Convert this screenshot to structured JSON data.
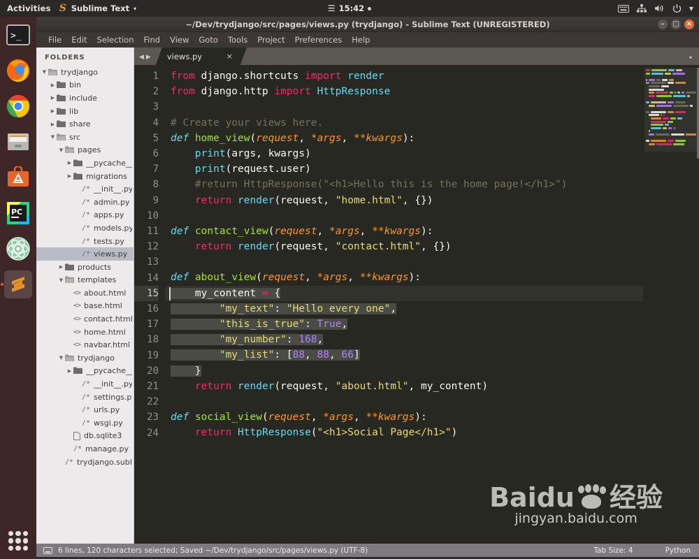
{
  "topbar": {
    "activities": "Activities",
    "app_name": "Sublime Text",
    "app_icon": "sublime-text-icon",
    "menu_chevron": "▾",
    "clock": "15:42",
    "clock_menu_icon": "hamburger-icon",
    "tray": [
      "keyboard-icon",
      "network-icon",
      "volume-icon",
      "power-icon",
      "chevron-down-icon"
    ]
  },
  "dock": {
    "items": [
      {
        "name": "terminal",
        "label": "Terminal"
      },
      {
        "name": "firefox",
        "label": "Firefox"
      },
      {
        "name": "chrome",
        "label": "Google Chrome"
      },
      {
        "name": "files",
        "label": "Files"
      },
      {
        "name": "ubuntu-software",
        "label": "Ubuntu Software"
      },
      {
        "name": "pycharm",
        "label": "PyCharm"
      },
      {
        "name": "atom",
        "label": "Atom"
      },
      {
        "name": "sublime-text",
        "label": "Sublime Text",
        "active": true
      }
    ],
    "show_apps_label": "Show Applications"
  },
  "window": {
    "title": "~/Dev/trydjango/src/pages/views.py (trydjango) - Sublime Text (UNREGISTERED)",
    "buttons": {
      "minimize": "–",
      "maximize": "□",
      "close": "×"
    }
  },
  "menubar": [
    "File",
    "Edit",
    "Selection",
    "Find",
    "View",
    "Goto",
    "Tools",
    "Project",
    "Preferences",
    "Help"
  ],
  "sidebar": {
    "header": "FOLDERS",
    "tree": [
      {
        "indent": 0,
        "arrow": "▾",
        "icon": "folder-open-icon",
        "label": "trydjango"
      },
      {
        "indent": 1,
        "arrow": "▸",
        "icon": "folder-icon",
        "label": "bin"
      },
      {
        "indent": 1,
        "arrow": "▸",
        "icon": "folder-icon",
        "label": "include"
      },
      {
        "indent": 1,
        "arrow": "▸",
        "icon": "folder-icon",
        "label": "lib"
      },
      {
        "indent": 1,
        "arrow": "▸",
        "icon": "folder-icon",
        "label": "share"
      },
      {
        "indent": 1,
        "arrow": "▾",
        "icon": "folder-open-icon",
        "label": "src"
      },
      {
        "indent": 2,
        "arrow": "▾",
        "icon": "folder-open-icon",
        "label": "pages"
      },
      {
        "indent": 3,
        "arrow": "▸",
        "icon": "folder-icon",
        "label": "__pycache__"
      },
      {
        "indent": 3,
        "arrow": "▸",
        "icon": "folder-icon",
        "label": "migrations"
      },
      {
        "indent": 4,
        "arrow": "",
        "icon": "python-file-icon",
        "label": "__init__.py"
      },
      {
        "indent": 4,
        "arrow": "",
        "icon": "python-file-icon",
        "label": "admin.py"
      },
      {
        "indent": 4,
        "arrow": "",
        "icon": "python-file-icon",
        "label": "apps.py"
      },
      {
        "indent": 4,
        "arrow": "",
        "icon": "python-file-icon",
        "label": "models.py"
      },
      {
        "indent": 4,
        "arrow": "",
        "icon": "python-file-icon",
        "label": "tests.py"
      },
      {
        "indent": 4,
        "arrow": "",
        "icon": "python-file-icon",
        "label": "views.py",
        "selected": true
      },
      {
        "indent": 2,
        "arrow": "▸",
        "icon": "folder-icon",
        "label": "products"
      },
      {
        "indent": 2,
        "arrow": "▾",
        "icon": "folder-open-icon",
        "label": "templates"
      },
      {
        "indent": 3,
        "arrow": "",
        "icon": "html-file-icon",
        "label": "about.html"
      },
      {
        "indent": 3,
        "arrow": "",
        "icon": "html-file-icon",
        "label": "base.html"
      },
      {
        "indent": 3,
        "arrow": "",
        "icon": "html-file-icon",
        "label": "contact.html"
      },
      {
        "indent": 3,
        "arrow": "",
        "icon": "html-file-icon",
        "label": "home.html"
      },
      {
        "indent": 3,
        "arrow": "",
        "icon": "html-file-icon",
        "label": "navbar.html"
      },
      {
        "indent": 2,
        "arrow": "▾",
        "icon": "folder-open-icon",
        "label": "trydjango"
      },
      {
        "indent": 3,
        "arrow": "▸",
        "icon": "folder-icon",
        "label": "__pycache__"
      },
      {
        "indent": 4,
        "arrow": "",
        "icon": "python-file-icon",
        "label": "__init__.py"
      },
      {
        "indent": 4,
        "arrow": "",
        "icon": "python-file-icon",
        "label": "settings.py"
      },
      {
        "indent": 4,
        "arrow": "",
        "icon": "python-file-icon",
        "label": "urls.py"
      },
      {
        "indent": 4,
        "arrow": "",
        "icon": "python-file-icon",
        "label": "wsgi.py"
      },
      {
        "indent": 3,
        "arrow": "",
        "icon": "generic-file-icon",
        "label": "db.sqlite3"
      },
      {
        "indent": 3,
        "arrow": "",
        "icon": "python-file-icon",
        "label": "manage.py"
      },
      {
        "indent": 2,
        "arrow": "",
        "icon": "python-file-icon",
        "label": "trydjango.sublime-p"
      }
    ]
  },
  "tabbar": {
    "nav_prev": "◀",
    "nav_next": "▶",
    "tabs": [
      {
        "label": "views.py",
        "close": "×",
        "active": true
      }
    ],
    "overflow_chevron": "▾"
  },
  "editor": {
    "language": "Python",
    "tab_size_label": "Tab Size: 4",
    "line_count": 24,
    "current_line": 15,
    "selection": {
      "from_line": 15,
      "to_line": 20
    },
    "lines": [
      {
        "n": 1,
        "text": "from django.shortcuts import render"
      },
      {
        "n": 2,
        "text": "from django.http import HttpResponse"
      },
      {
        "n": 3,
        "text": ""
      },
      {
        "n": 4,
        "text": "# Create your views here."
      },
      {
        "n": 5,
        "text": "def home_view(request, *args, **kwargs):"
      },
      {
        "n": 6,
        "text": "    print(args, kwargs)"
      },
      {
        "n": 7,
        "text": "    print(request.user)"
      },
      {
        "n": 8,
        "text": "    #return HttpResponse(\"<h1>Hello this is the home page!</h1>\")"
      },
      {
        "n": 9,
        "text": "    return render(request, \"home.html\", {})"
      },
      {
        "n": 10,
        "text": ""
      },
      {
        "n": 11,
        "text": "def contact_view(request, *args, **kwargs):"
      },
      {
        "n": 12,
        "text": "    return render(request, \"contact.html\", {})"
      },
      {
        "n": 13,
        "text": ""
      },
      {
        "n": 14,
        "text": "def about_view(request, *args, **kwargs):"
      },
      {
        "n": 15,
        "text": "    my_content = {"
      },
      {
        "n": 16,
        "text": "        \"my_text\": \"Hello every one\","
      },
      {
        "n": 17,
        "text": "        \"this_is_true\": True,"
      },
      {
        "n": 18,
        "text": "        \"my_number\": 168,"
      },
      {
        "n": 19,
        "text": "        \"my_list\": [88, 88, 66]"
      },
      {
        "n": 20,
        "text": "    }"
      },
      {
        "n": 21,
        "text": "    return render(request, \"about.html\", my_content)"
      },
      {
        "n": 22,
        "text": ""
      },
      {
        "n": 23,
        "text": "def social_view(request, *args, **kwargs):"
      },
      {
        "n": 24,
        "text": "    return HttpResponse(\"<h1>Social Page</h1>\")"
      }
    ],
    "colors": {
      "background": "#272822",
      "foreground": "#f8f8f2",
      "keyword": "#f92672",
      "function": "#a6e22e",
      "parameter": "#fd971f",
      "builtin": "#66d9ef",
      "string": "#e6db74",
      "number": "#ae81ff",
      "comment": "#75715e",
      "selection": "#4a4b44"
    }
  },
  "statusbar": {
    "icon": "console-icon",
    "message": "6 lines, 120 characters selected; Saved ~/Dev/trydjango/src/pages/views.py (UTF-8)",
    "tab_size": "Tab Size: 4",
    "syntax": "Python"
  },
  "watermark": {
    "brand": "Baidu",
    "brand_cn": "经验",
    "url": "jingyan.baidu.com"
  }
}
